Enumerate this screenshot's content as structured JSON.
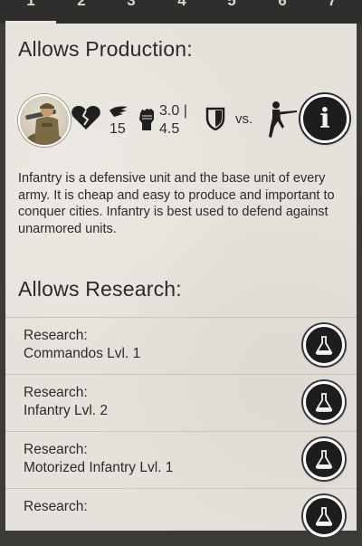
{
  "tabs": [
    "1",
    "2",
    "3",
    "4",
    "5",
    "6",
    "7"
  ],
  "allows_production": {
    "heading": "Allows Production:",
    "unit_icon": "infantry-soldier-avatar",
    "stats": {
      "health_icon": "broken-heart-icon",
      "speed_icon": "wing-icon",
      "speed_value": "15",
      "attack_icon": "fist-icon",
      "attack_value_line1": "3.0 |",
      "attack_value_line2": "4.5",
      "defense_icon": "shield-icon",
      "vs_label": "vs.",
      "target_icon": "rifleman-icon"
    },
    "info_button_icon": "info-icon",
    "description": "Infantry is a defensive unit and the base unit of every army. It is cheap and easy to produce and important to conquer cities. Infantry is best used to defend against unarmored units."
  },
  "allows_research": {
    "heading": "Allows Research:",
    "items": [
      {
        "line1": "Research:",
        "line2": "Commandos Lvl. 1"
      },
      {
        "line1": "Research:",
        "line2": "Infantry Lvl. 2"
      },
      {
        "line1": "Research:",
        "line2": "Motorized Infantry Lvl. 1"
      },
      {
        "line1": "Research:",
        "line2": ""
      }
    ],
    "button_icon": "flask-icon"
  },
  "colors": {
    "panel_bg": "#e6e2db",
    "top_bar_bg": "#2e2e2c",
    "button_bg": "#1d1d1d"
  }
}
